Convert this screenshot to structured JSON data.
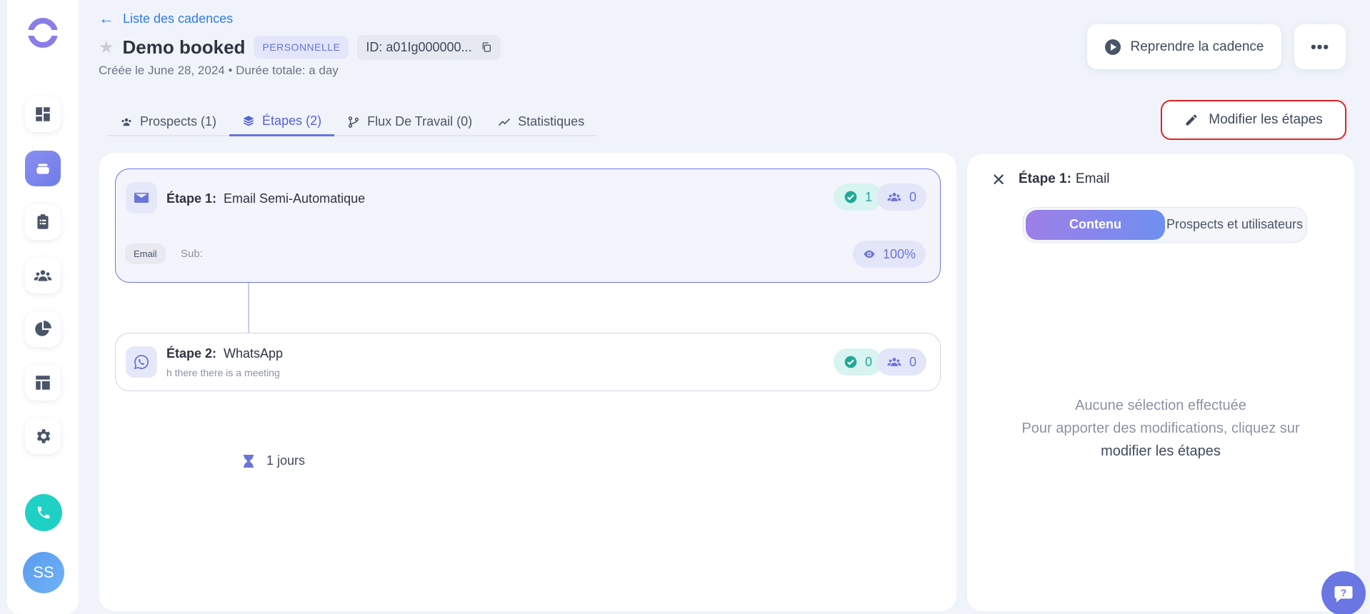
{
  "sidebar": {
    "avatar_initials": "SS",
    "items": [
      {
        "name": "dashboard"
      },
      {
        "name": "cadences"
      },
      {
        "name": "tasks"
      },
      {
        "name": "people"
      },
      {
        "name": "reports"
      },
      {
        "name": "templates"
      },
      {
        "name": "settings"
      }
    ]
  },
  "header": {
    "back_label": "Liste des cadences",
    "title": "Demo booked",
    "type_badge": "PERSONNELLE",
    "id_label": "ID: a01Ig000000...",
    "subtitle": "Créée le June 28, 2024 • Durée totale: a day",
    "resume_label": "Reprendre la cadence",
    "more_label": "•••"
  },
  "tabs": [
    {
      "label": "Prospects (1)",
      "active": false
    },
    {
      "label": "Étapes (2)",
      "active": true
    },
    {
      "label": "Flux De Travail (0)",
      "active": false
    },
    {
      "label": "Statistiques",
      "active": false
    }
  ],
  "modify_button": "Modifier les étapes",
  "steps": [
    {
      "prefix": "Étape 1:",
      "name": "Email Semi-Automatique",
      "done": "1",
      "people": "0",
      "tag": "Email",
      "sub": "Sub:",
      "open_rate": "100%"
    },
    {
      "prefix": "Étape 2:",
      "name": "WhatsApp",
      "description": "h there there is a meeting",
      "done": "0",
      "people": "0"
    }
  ],
  "delay_label": "1 jours",
  "right_panel": {
    "title_prefix": "Étape 1:",
    "title_name": "Email",
    "toggle_active": "Contenu",
    "toggle_other": "Prospects et utilisateurs",
    "empty_line1": "Aucune sélection effectuée",
    "empty_line2": "Pour apporter des modifications, cliquez sur",
    "empty_link": "modifier les étapes"
  },
  "colors": {
    "accent": "#6a72e0",
    "link": "#2f7be8",
    "success": "#22a897",
    "highlight_border": "#e02424"
  }
}
